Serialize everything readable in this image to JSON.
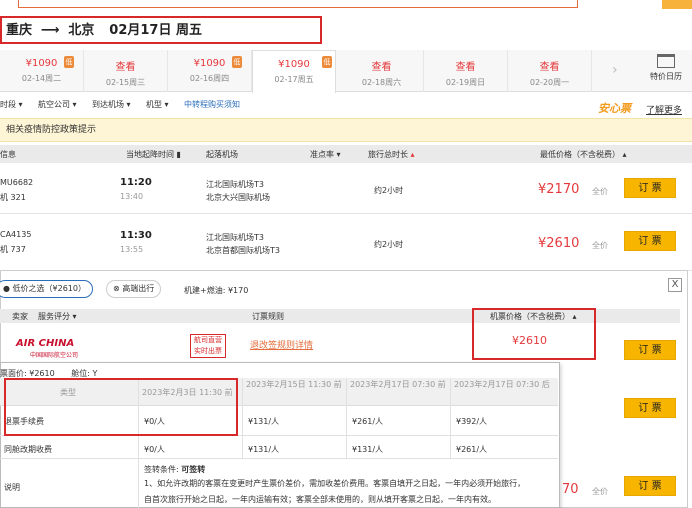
{
  "route": {
    "from": "重庆",
    "arrow": "⟶",
    "to": "北京",
    "date": "02月17日 周五"
  },
  "date_tabs": [
    {
      "price": "¥1090",
      "date": "02-14周二",
      "low": true
    },
    {
      "price": "查看",
      "date": "02-15周三",
      "low": false
    },
    {
      "price": "¥1090",
      "date": "02-16周四",
      "low": true
    },
    {
      "price": "¥1090",
      "date": "02-17周五",
      "low": true,
      "active": true
    },
    {
      "price": "查看",
      "date": "02-18周六",
      "low": false
    },
    {
      "price": "查看",
      "date": "02-19周日",
      "low": false
    },
    {
      "price": "查看",
      "date": "02-20周一",
      "low": false
    }
  ],
  "low_badge": "低",
  "date_arrow": "›",
  "calendar_label": "特价日历",
  "filters": {
    "depart_time": "时段",
    "airline": "航空公司",
    "arrive_airport": "到达机场",
    "plane": "机型",
    "transfer": "中转程购买须知"
  },
  "anxin": {
    "title": "安心票",
    "learn_more": "了解更多"
  },
  "notice": "相关疫情防控政策提示",
  "columns": {
    "info": "信息",
    "time": "当地起降时间",
    "airport": "起落机场",
    "ontime": "准点率",
    "duration": "旅行总时长",
    "price": "最低价格（不含税费）"
  },
  "flights": [
    {
      "no": "MU6682",
      "plane": "机 321",
      "dep": "11:20",
      "arr": "13:40",
      "from": "江北国际机场T3",
      "to": "北京大兴国际机场",
      "duration": "约2小时",
      "price": "¥2170",
      "tag": "全价",
      "book": "订 票"
    },
    {
      "no": "CA4135",
      "plane": "机 737",
      "dep": "11:30",
      "arr": "13:55",
      "from": "江北国际机场T3",
      "to": "北京首都国际机场T3",
      "duration": "约2小时",
      "price": "¥2610",
      "tag": "全价",
      "book": "订 票"
    }
  ],
  "panel": {
    "pill_low": "低价之选（¥2610）",
    "pill_high": "高端出行",
    "tax": "机建+燃油: ¥170",
    "close": "X",
    "sub_seller": "卖家",
    "sub_service": "服务评分",
    "sub_rules": "订票规则",
    "sub_price": "机票价格（不含税费）",
    "airline_logo": "AIR CHINA",
    "airline_sub": "中国国际航空公司",
    "direct_badge_1": "航司直营",
    "direct_badge_2": "实时出票",
    "rule_link": "退改签规则详情",
    "price": "¥2610",
    "book": "订 票",
    "book2": "订 票",
    "book3": "订 票",
    "bottom_price": "70",
    "bottom_tag": "全价"
  },
  "popup": {
    "fare_label": "票面价: ¥2610",
    "cabin_label": "舱位: Y",
    "type_header": "类型",
    "col_headers": [
      "2023年2月3日 11:30 前",
      "2023年2月15日 11:30 前",
      "2023年2月17日 07:30 前",
      "2023年2月17日 07:30 后"
    ],
    "rows": [
      {
        "label": "退票手续费",
        "values": [
          "¥0/人",
          "¥131/人",
          "¥261/人",
          "¥392/人"
        ]
      },
      {
        "label": "同舱改期收费",
        "values": [
          "¥0/人",
          "¥131/人",
          "¥131/人",
          "¥261/人"
        ]
      }
    ],
    "note_label": "说明",
    "sign_label": "签转条件:",
    "sign_value": "可签转",
    "desc_1": "1、如允许改期的客票在变更时产生票价差价，需加收差价费用。客票自填开之日起，一年内必须开始旅行，",
    "desc_2": "自首次旅行开始之日起，一年内运输有效；客票全部未使用的，则从填开客票之日起，一年内有效。"
  }
}
